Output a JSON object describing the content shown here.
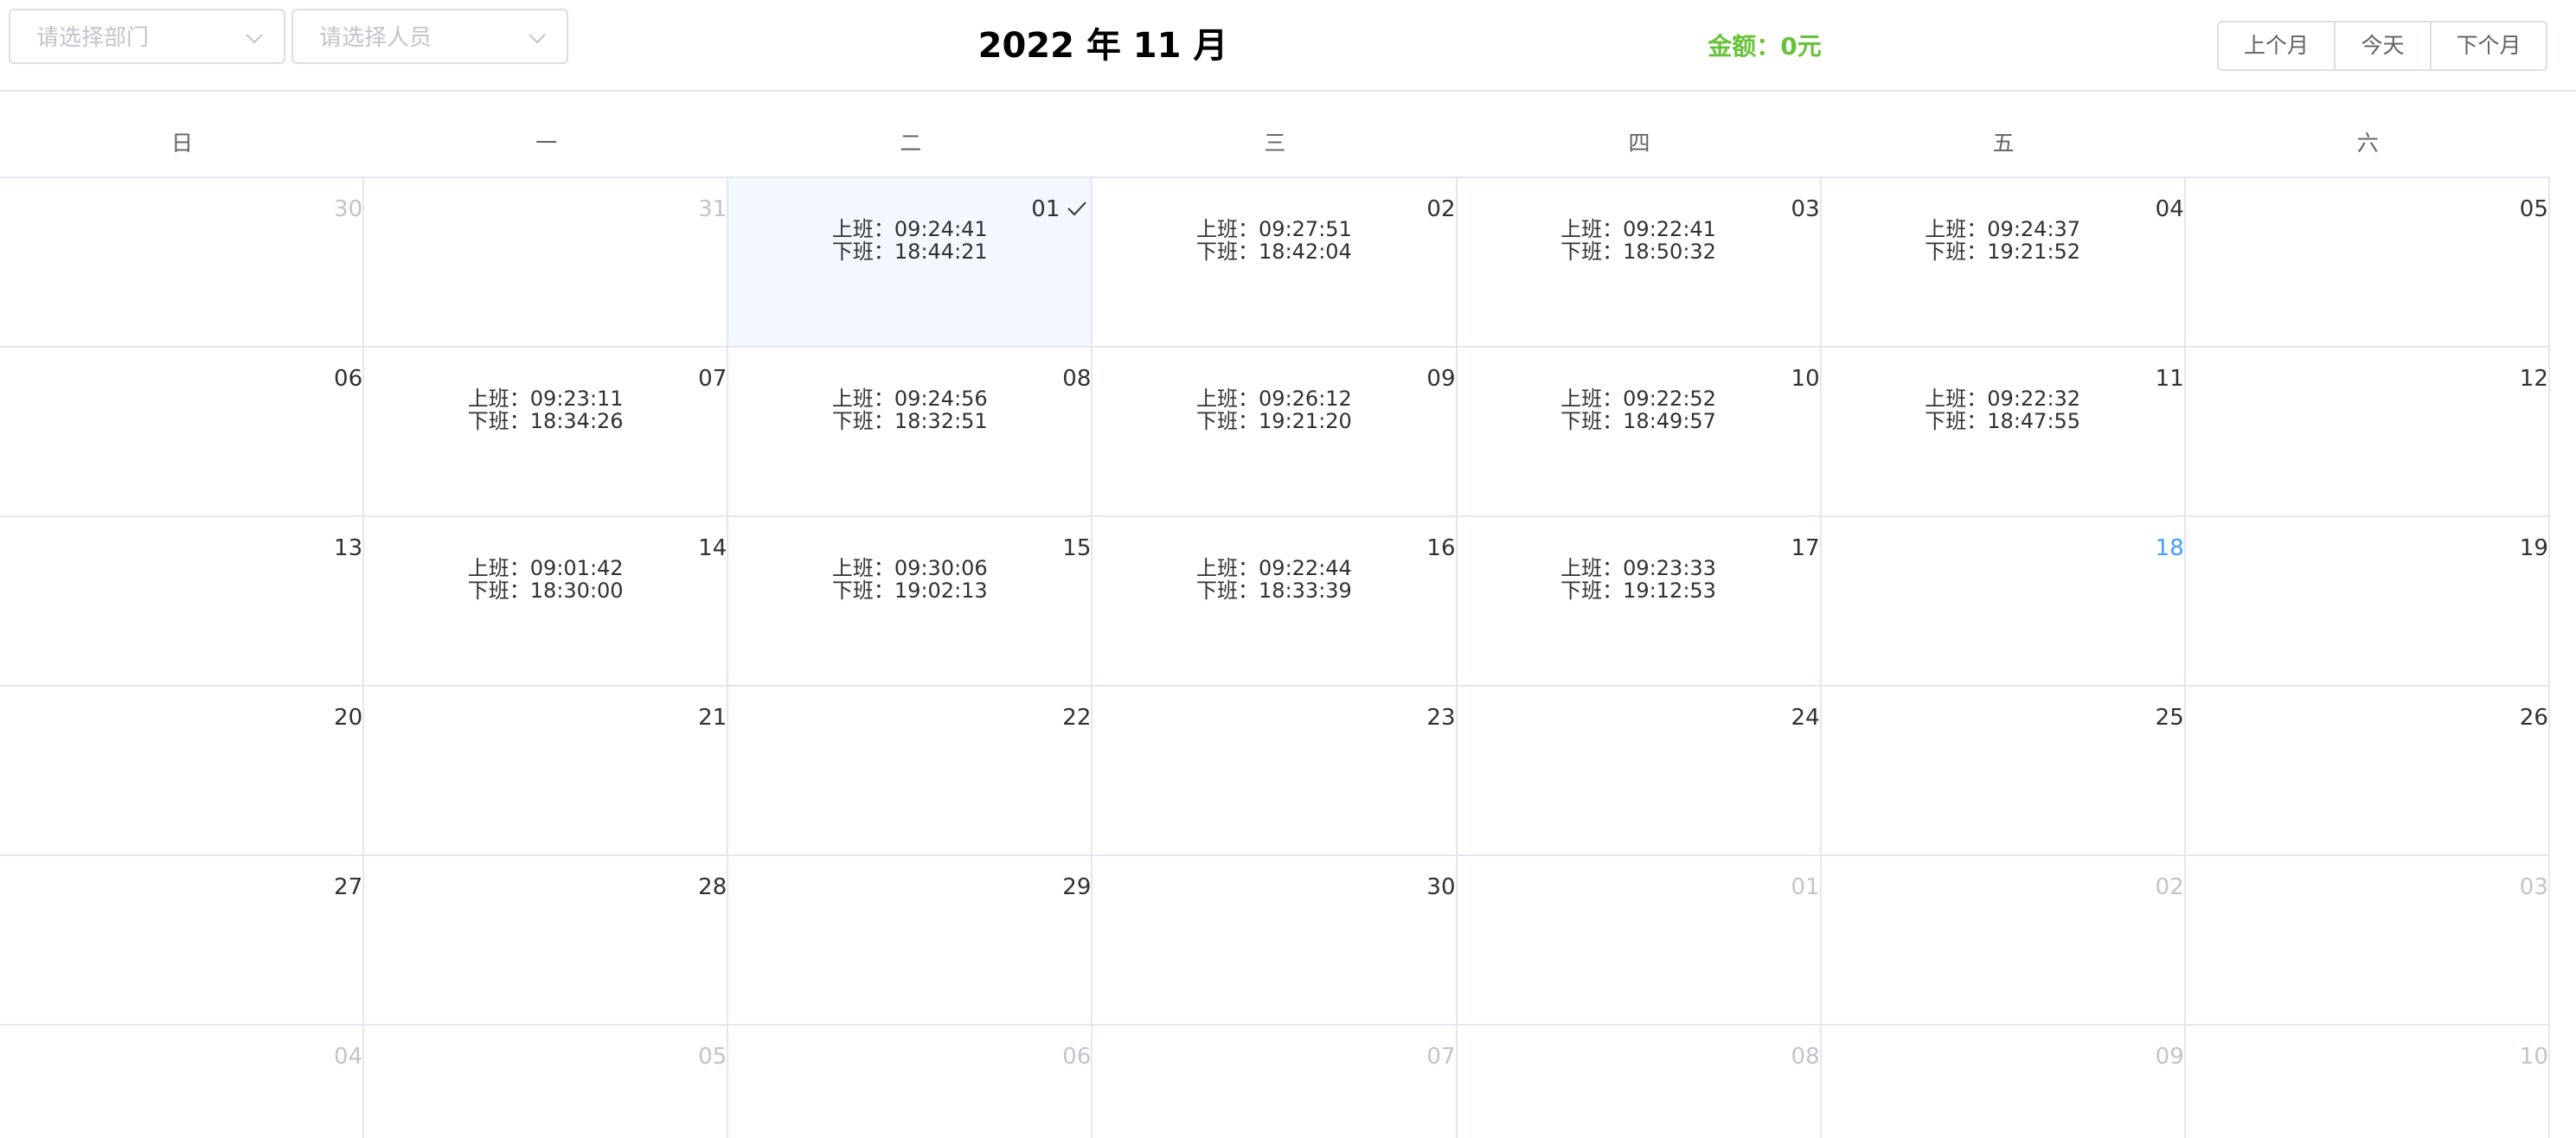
{
  "filters": {
    "department_placeholder": "请选择部门",
    "staff_placeholder": "请选择人员"
  },
  "title": "2022 年 11 月",
  "amount": {
    "label": "金额：",
    "value": "0元"
  },
  "nav": {
    "prev": "上个月",
    "today": "今天",
    "next": "下个月"
  },
  "weekdays": [
    "日",
    "一",
    "二",
    "三",
    "四",
    "五",
    "六"
  ],
  "colors": {
    "amount": "#67c23a",
    "today": "#409eff",
    "selected_bg": "#f2f8fe",
    "muted": "#c0c4cc"
  },
  "weeks": [
    [
      {
        "day": "30",
        "other": true
      },
      {
        "day": "31",
        "other": true
      },
      {
        "day": "01",
        "selected": true,
        "in": "上班：09:24:41",
        "out": "下班：18:44:21"
      },
      {
        "day": "02",
        "in": "上班：09:27:51",
        "out": "下班：18:42:04"
      },
      {
        "day": "03",
        "in": "上班：09:22:41",
        "out": "下班：18:50:32"
      },
      {
        "day": "04",
        "in": "上班：09:24:37",
        "out": "下班：19:21:52"
      },
      {
        "day": "05"
      }
    ],
    [
      {
        "day": "06"
      },
      {
        "day": "07",
        "in": "上班：09:23:11",
        "out": "下班：18:34:26"
      },
      {
        "day": "08",
        "in": "上班：09:24:56",
        "out": "下班：18:32:51"
      },
      {
        "day": "09",
        "in": "上班：09:26:12",
        "out": "下班：19:21:20"
      },
      {
        "day": "10",
        "in": "上班：09:22:52",
        "out": "下班：18:49:57"
      },
      {
        "day": "11",
        "in": "上班：09:22:32",
        "out": "下班：18:47:55"
      },
      {
        "day": "12"
      }
    ],
    [
      {
        "day": "13"
      },
      {
        "day": "14",
        "in": "上班：09:01:42",
        "out": "下班：18:30:00"
      },
      {
        "day": "15",
        "in": "上班：09:30:06",
        "out": "下班：19:02:13"
      },
      {
        "day": "16",
        "in": "上班：09:22:44",
        "out": "下班：18:33:39"
      },
      {
        "day": "17",
        "in": "上班：09:23:33",
        "out": "下班：19:12:53"
      },
      {
        "day": "18",
        "today": true
      },
      {
        "day": "19"
      }
    ],
    [
      {
        "day": "20"
      },
      {
        "day": "21"
      },
      {
        "day": "22"
      },
      {
        "day": "23"
      },
      {
        "day": "24"
      },
      {
        "day": "25"
      },
      {
        "day": "26"
      }
    ],
    [
      {
        "day": "27"
      },
      {
        "day": "28"
      },
      {
        "day": "29"
      },
      {
        "day": "30"
      },
      {
        "day": "01",
        "other": true
      },
      {
        "day": "02",
        "other": true
      },
      {
        "day": "03",
        "other": true
      }
    ],
    [
      {
        "day": "04",
        "other": true
      },
      {
        "day": "05",
        "other": true
      },
      {
        "day": "06",
        "other": true
      },
      {
        "day": "07",
        "other": true
      },
      {
        "day": "08",
        "other": true
      },
      {
        "day": "09",
        "other": true
      },
      {
        "day": "10",
        "other": true
      }
    ]
  ]
}
